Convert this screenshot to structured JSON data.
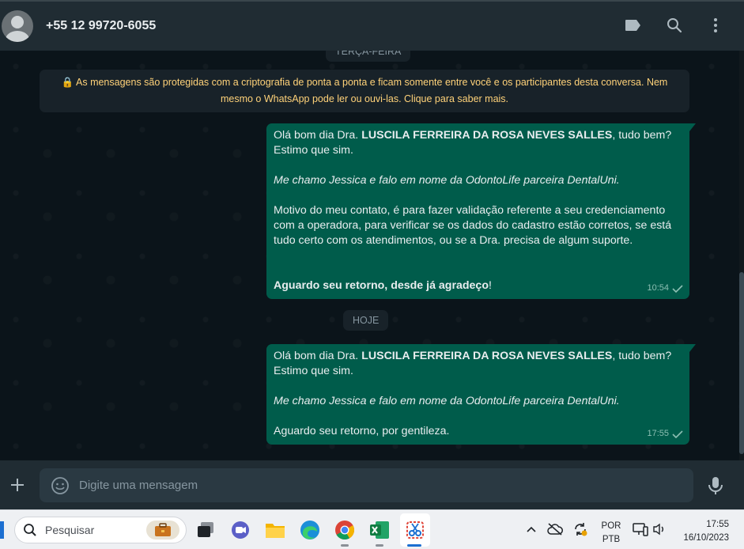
{
  "header": {
    "contact": "+55 12 99720-6055",
    "icons": [
      "label-icon",
      "search-icon",
      "kebab-menu-icon"
    ]
  },
  "chat": {
    "day_old": "TERÇA-FEIRA",
    "encryption_notice": "🔒 As mensagens são protegidas com a criptografia de ponta a ponta e ficam somente entre você e os participantes desta conversa. Nem mesmo o WhatsApp pode ler ou ouvi-las. Clique para saber mais.",
    "day_today": "HOJE",
    "messages": [
      {
        "p1_pre": "Olá bom dia Dra. ",
        "p1_bold": "LUSCILA FERREIRA DA ROSA NEVES SALLES",
        "p1_post": ", tudo bem? Estimo que sim.",
        "p2_italic": "Me chamo Jessica e falo em nome da OdontoLife parceira DentalUni.",
        "p3": "Motivo do meu contato, é para fazer validação referente a seu credenciamento com a operadora, para verificar se os dados do cadastro estão corretos, se está tudo certo com os atendimentos, ou se a Dra. precisa de algum suporte.",
        "p4_bold": "Aguardo seu retorno, desde já agradeço",
        "p4_post": "!",
        "time": "10:54"
      },
      {
        "p1_pre": "Olá bom dia Dra. ",
        "p1_bold": "LUSCILA FERREIRA DA ROSA NEVES SALLES",
        "p1_post": ", tudo bem? Estimo que sim.",
        "p2_italic": "Me chamo Jessica e falo em nome da OdontoLife parceira DentalUni.",
        "p3": "Aguardo seu retorno, por gentileza.",
        "time": "17:55"
      }
    ]
  },
  "composer": {
    "placeholder": "Digite uma mensagem"
  },
  "taskbar": {
    "search_label": "Pesquisar",
    "lang_line1": "POR",
    "lang_line2": "PTB",
    "time": "17:55",
    "date": "16/10/2023"
  },
  "colors": {
    "header": "#202c33",
    "bubble_out": "#005c4b",
    "chat_bg": "#0b141a",
    "encryption_text": "#ffd279"
  }
}
